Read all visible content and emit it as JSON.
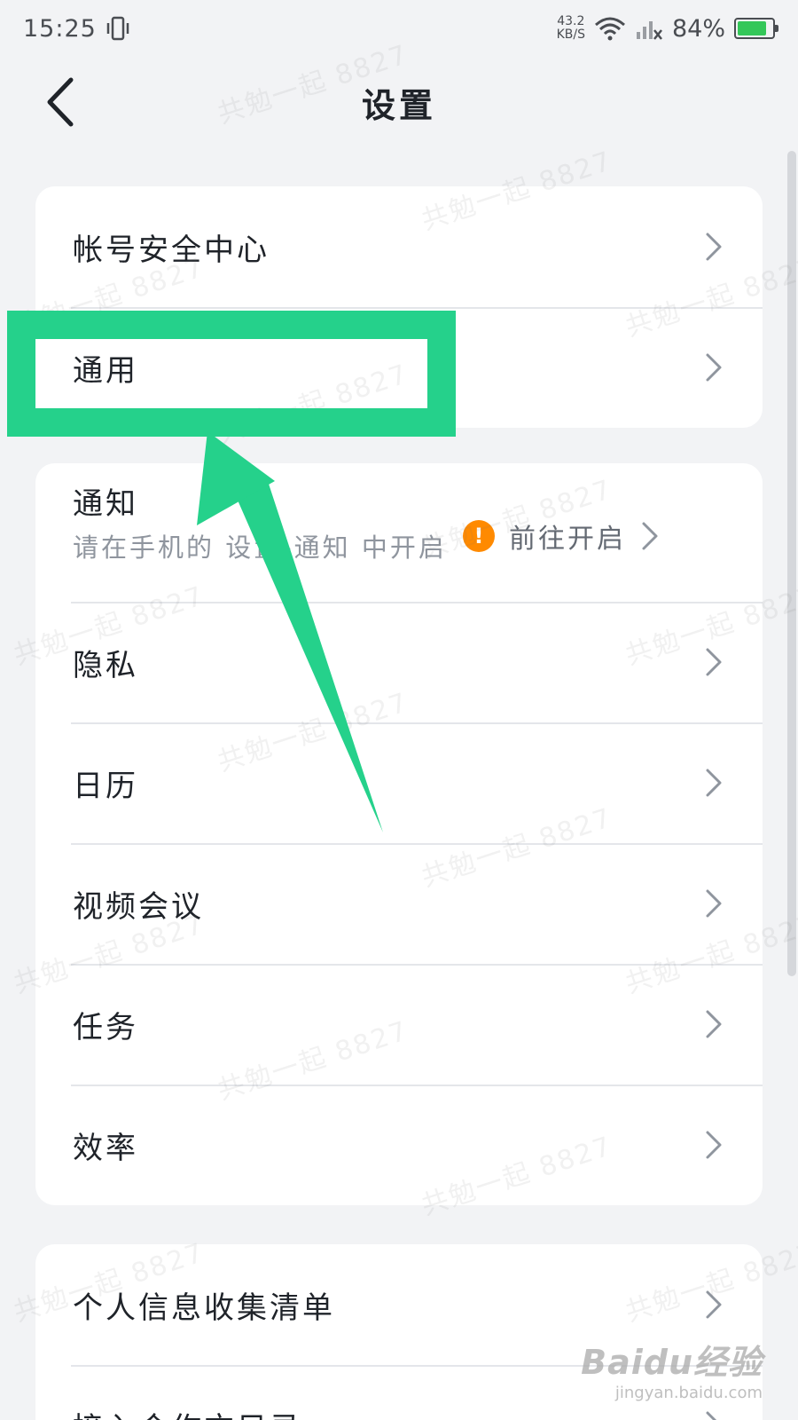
{
  "status_bar": {
    "time": "15:25",
    "net_speed_value": "43.2",
    "net_speed_unit": "KB/S",
    "battery": "84%",
    "battery_level": 0.84
  },
  "header": {
    "title": "设置",
    "back_icon": "chevron-left-icon"
  },
  "sections": [
    {
      "items": [
        {
          "label": "帐号安全中心"
        },
        {
          "label": "通用"
        }
      ]
    },
    {
      "notification": {
        "label": "通知",
        "subtitle": "请在手机的 设置-通知 中开启",
        "action": "前往开启",
        "badge": "!"
      },
      "items": [
        {
          "label": "隐私"
        },
        {
          "label": "日历"
        },
        {
          "label": "视频会议"
        },
        {
          "label": "任务"
        },
        {
          "label": "效率"
        }
      ]
    },
    {
      "items": [
        {
          "label": "个人信息收集清单"
        },
        {
          "label": "接入合作方目录"
        }
      ]
    }
  ],
  "watermark": "共勉一起 8827",
  "baidu": {
    "logo": "Baidu经验",
    "url": "jingyan.baidu.com"
  },
  "colors": {
    "accent_highlight": "#25d18b",
    "warning": "#ff8a00",
    "battery": "#34c759"
  }
}
